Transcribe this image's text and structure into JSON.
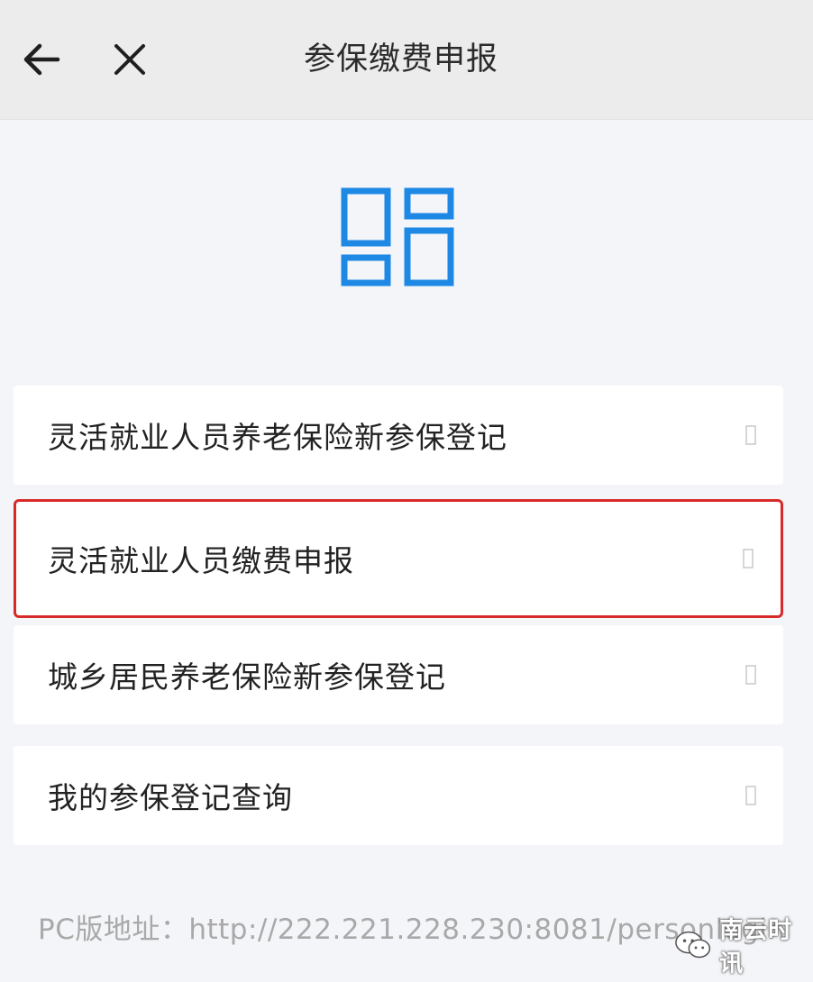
{
  "header": {
    "title": "参保缴费申报",
    "back_icon": "arrow-left-icon",
    "close_icon": "close-icon"
  },
  "main_icon": {
    "name": "grid-layout-icon",
    "color": "#1e88e5"
  },
  "menu": {
    "items": [
      {
        "label": "灵活就业人员养老保险新参保登记",
        "icon": "chevron-right-icon"
      },
      {
        "label": "灵活就业人员缴费申报",
        "icon": "chevron-right-icon",
        "highlighted": true,
        "highlight_color": "#d92a2a"
      },
      {
        "label": "城乡居民养老保险新参保登记",
        "icon": "chevron-right-icon"
      },
      {
        "label": "我的参保登记查询",
        "icon": "chevron-right-icon"
      }
    ]
  },
  "footer": {
    "pc_address": "PC版地址：http://222.221.228.230:8081/personlogin"
  },
  "watermark": {
    "text": "南云时讯",
    "icon": "wechat-icon"
  }
}
